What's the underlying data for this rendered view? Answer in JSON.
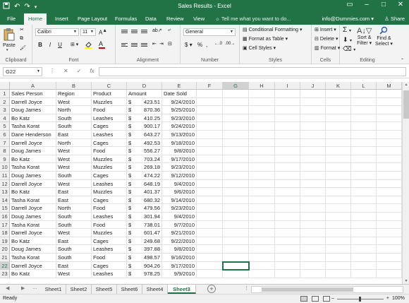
{
  "window": {
    "title": "Sales Results - Excel",
    "qat_icons": [
      "save-icon",
      "undo-icon",
      "redo-icon",
      "customize-icon"
    ],
    "controls": [
      "ribbon-display-icon",
      "minimize-icon",
      "maximize-icon",
      "close-icon"
    ]
  },
  "tabs": [
    "File",
    "Home",
    "Insert",
    "Page Layout",
    "Formulas",
    "Data",
    "Review",
    "View"
  ],
  "active_tab": "Home",
  "tell_me": "Tell me what you want to do...",
  "account": "info@Dummies.com",
  "share": "Share",
  "ribbon": {
    "clipboard": {
      "label": "Clipboard",
      "paste": "Paste"
    },
    "font": {
      "label": "Font",
      "name": "Calibri",
      "size": "11",
      "bold": "B",
      "italic": "I",
      "underline": "U"
    },
    "alignment": {
      "label": "Alignment"
    },
    "number": {
      "label": "Number",
      "format": "General",
      "dollar": "$",
      "percent": "%",
      "comma": ","
    },
    "styles": {
      "label": "Styles",
      "conditional": "Conditional Formatting",
      "format_table": "Format as Table",
      "cell_styles": "Cell Styles"
    },
    "cells": {
      "label": "Cells",
      "insert": "Insert",
      "delete": "Delete",
      "format": "Format"
    },
    "editing": {
      "label": "Editing",
      "sort_filter": "Sort &",
      "sort_filter2": "Filter",
      "find_select": "Find &",
      "find_select2": "Select"
    }
  },
  "formula_bar": {
    "name_box": "G22",
    "value": ""
  },
  "columns": [
    "A",
    "B",
    "C",
    "D",
    "E",
    "F",
    "G",
    "H",
    "I",
    "J",
    "K",
    "L",
    "M"
  ],
  "selected_column": "G",
  "selected_row": 22,
  "headers": [
    "Sales Person",
    "Region",
    "Product",
    "Amount",
    "Date Sold"
  ],
  "rows": [
    [
      "Darrell Joyce",
      "West",
      "Muzzles",
      "$",
      "423.51",
      "9/24/2010"
    ],
    [
      "Doug James",
      "North",
      "Food",
      "$",
      "870.36",
      "9/25/2010"
    ],
    [
      "Bo Katz",
      "South",
      "Leashes",
      "$",
      "410.25",
      "9/23/2010"
    ],
    [
      "Tasha Korat",
      "South",
      "Cages",
      "$",
      "900.17",
      "9/24/2010"
    ],
    [
      "Dane Henderson",
      "East",
      "Leashes",
      "$",
      "643.27",
      "9/13/2010"
    ],
    [
      "Darrell Joyce",
      "North",
      "Cages",
      "$",
      "492.53",
      "9/18/2010"
    ],
    [
      "Doug James",
      "West",
      "Food",
      "$",
      "556.27",
      "9/8/2010"
    ],
    [
      "Bo Katz",
      "West",
      "Muzzles",
      "$",
      "703.24",
      "9/17/2010"
    ],
    [
      "Tasha Korat",
      "West",
      "Muzzles",
      "$",
      "269.18",
      "9/23/2010"
    ],
    [
      "Doug James",
      "South",
      "Cages",
      "$",
      "474.22",
      "9/12/2010"
    ],
    [
      "Darrell Joyce",
      "West",
      "Leashes",
      "$",
      "648.19",
      "9/4/2010"
    ],
    [
      "Bo Katz",
      "East",
      "Muzzles",
      "$",
      "401.37",
      "9/6/2010"
    ],
    [
      "Tasha Korat",
      "East",
      "Cages",
      "$",
      "680.32",
      "9/14/2010"
    ],
    [
      "Darrell Joyce",
      "North",
      "Food",
      "$",
      "479.56",
      "9/23/2010"
    ],
    [
      "Doug James",
      "South",
      "Leashes",
      "$",
      "301.94",
      "9/4/2010"
    ],
    [
      "Tasha Korat",
      "South",
      "Food",
      "$",
      "738.01",
      "9/7/2010"
    ],
    [
      "Darrell Joyce",
      "West",
      "Muzzles",
      "$",
      "601.47",
      "9/21/2010"
    ],
    [
      "Bo Katz",
      "East",
      "Cages",
      "$",
      "249.68",
      "9/22/2010"
    ],
    [
      "Doug James",
      "South",
      "Leashes",
      "$",
      "397.88",
      "9/8/2010"
    ],
    [
      "Tasha Korat",
      "South",
      "Food",
      "$",
      "498.57",
      "9/16/2010"
    ],
    [
      "Darrell Joyce",
      "East",
      "Cages",
      "$",
      "904.26",
      "9/17/2010"
    ],
    [
      "Bo Katz",
      "West",
      "Leashes",
      "$",
      "978.25",
      "9/9/2010"
    ]
  ],
  "sheet_tabs": [
    "Sheet1",
    "Sheet2",
    "Sheet5",
    "Sheet6",
    "Sheet4",
    "Sheet3"
  ],
  "active_sheet": "Sheet3",
  "status": "Ready",
  "zoom": "100%",
  "colors": {
    "excel_green": "#217346"
  }
}
